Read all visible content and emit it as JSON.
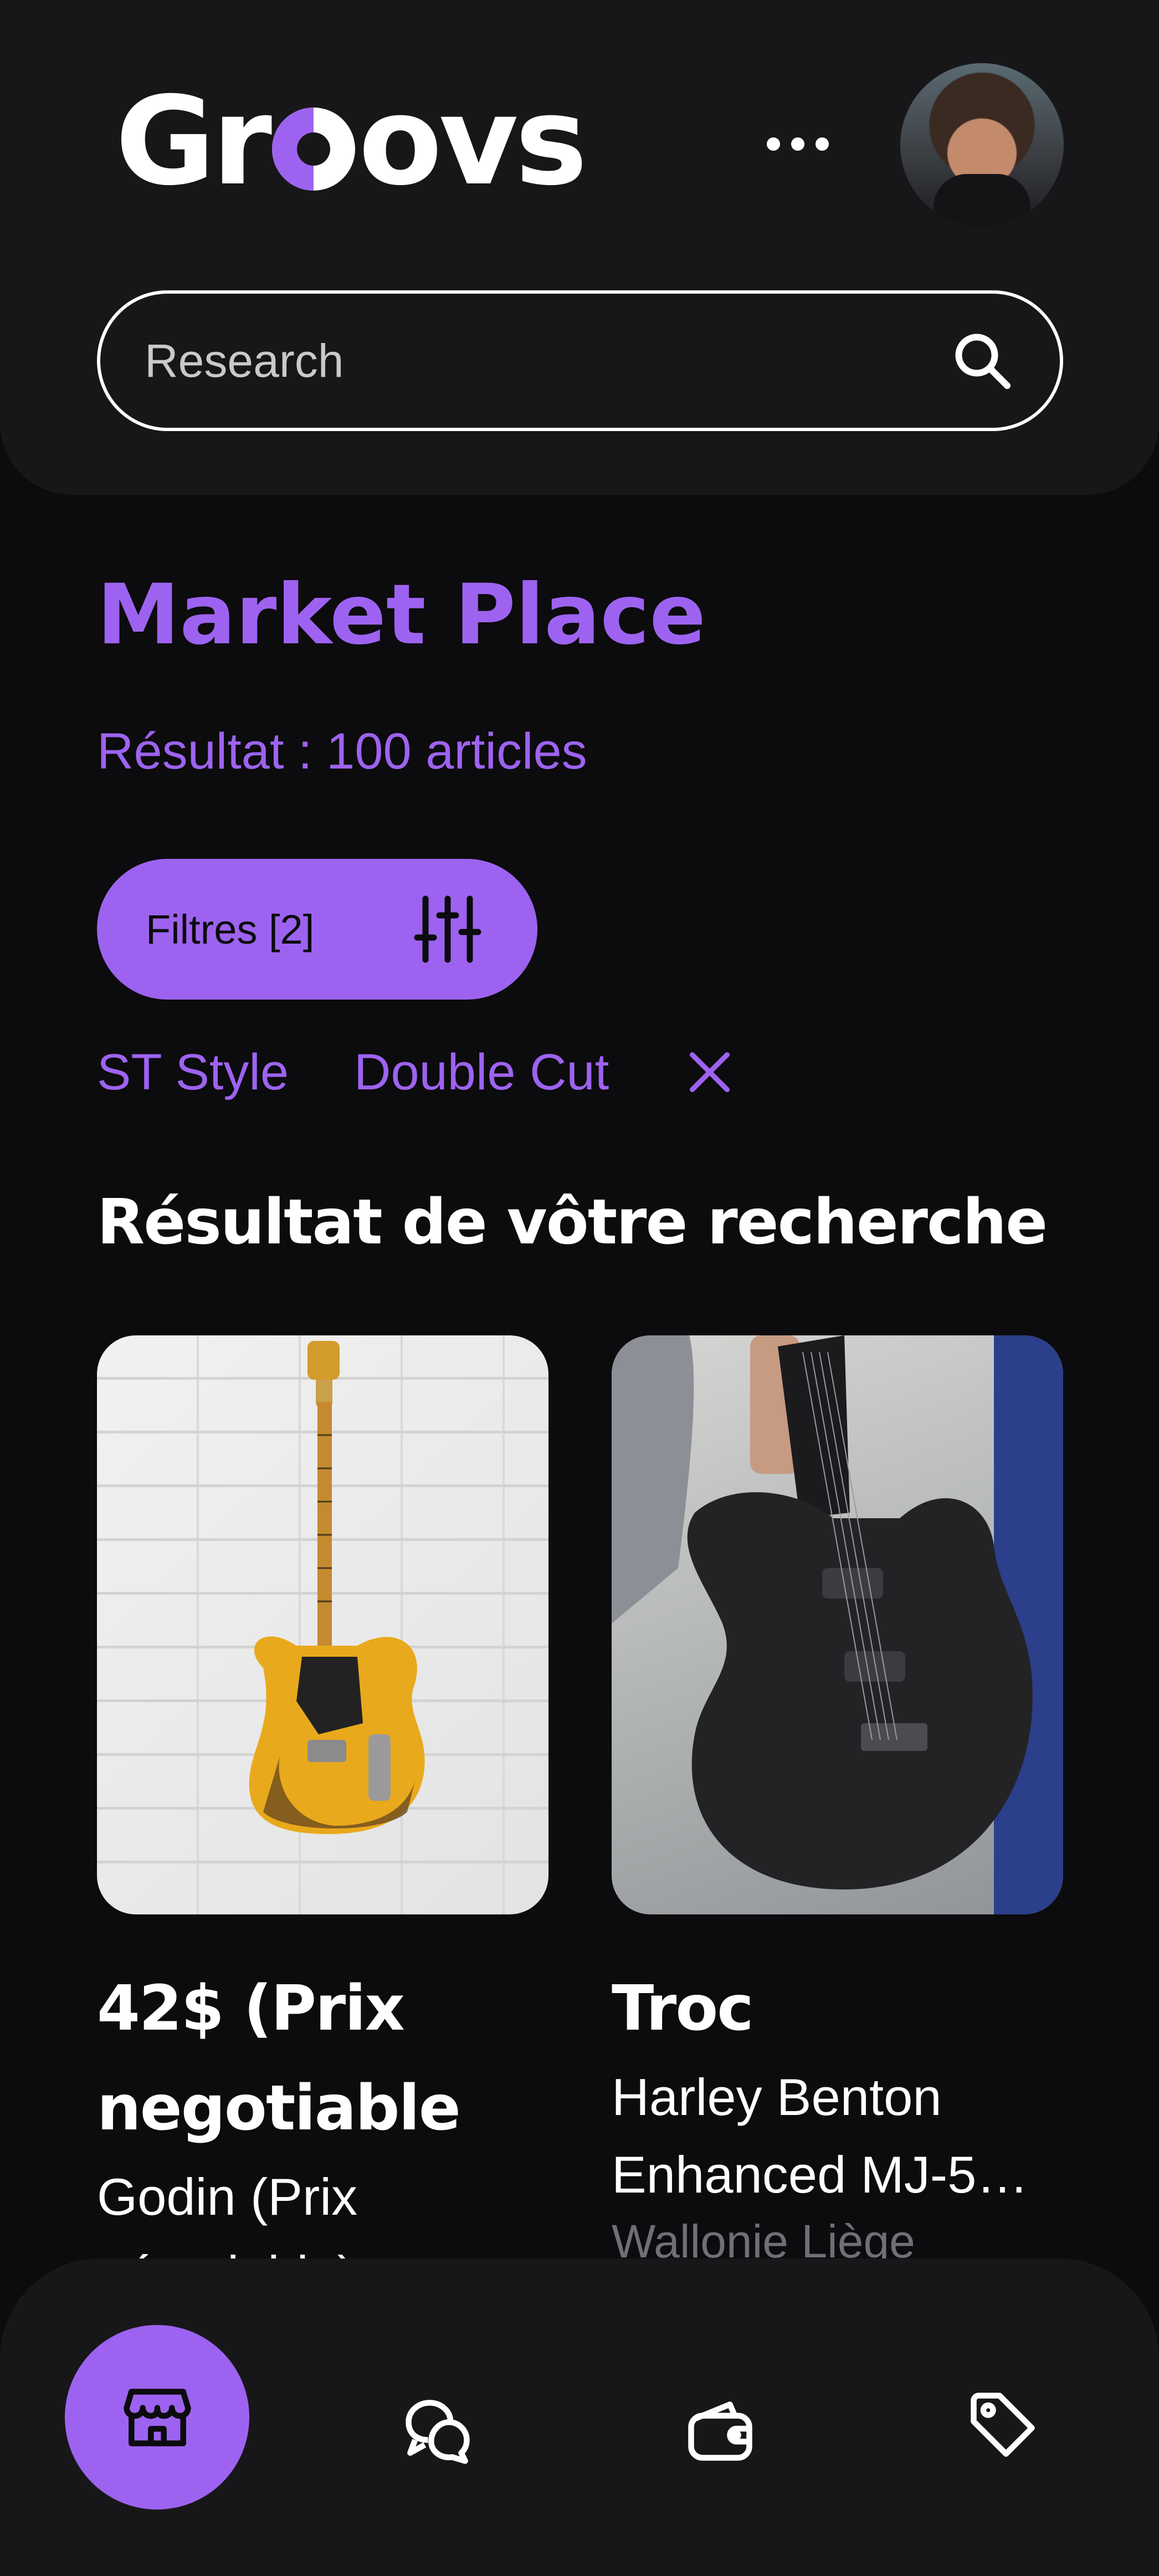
{
  "header": {
    "logo": {
      "part1": "Gr",
      "part2": "ovs"
    },
    "menu_icon": "more-horizontal-icon",
    "avatar_alt": "avatar"
  },
  "search": {
    "placeholder": "Research",
    "icon": "search-icon"
  },
  "main": {
    "title": "Market Place",
    "result_count": "Résultat : 100 articles",
    "filters_label": "Filtres [2]",
    "tags": [
      "ST Style",
      "Double Cut"
    ],
    "results_heading": "Résultat de vôtre recherche"
  },
  "listings": [
    {
      "price": "42$ (Prix negotiable",
      "name": "Godin (Prix négotiable)",
      "location": ""
    },
    {
      "price": "Troc",
      "name": "Harley Benton Enhanced MJ-5…",
      "location": "Wallonie Liège"
    }
  ],
  "bottom_nav": {
    "items": [
      "store-icon",
      "chat-icon",
      "wallet-icon",
      "tag-icon"
    ],
    "active": "store-icon"
  },
  "colors": {
    "accent": "#9d63f0",
    "background": "#0c0b0d",
    "surface": "#171719",
    "text": "#ffffff",
    "muted": "#6f6f74"
  }
}
